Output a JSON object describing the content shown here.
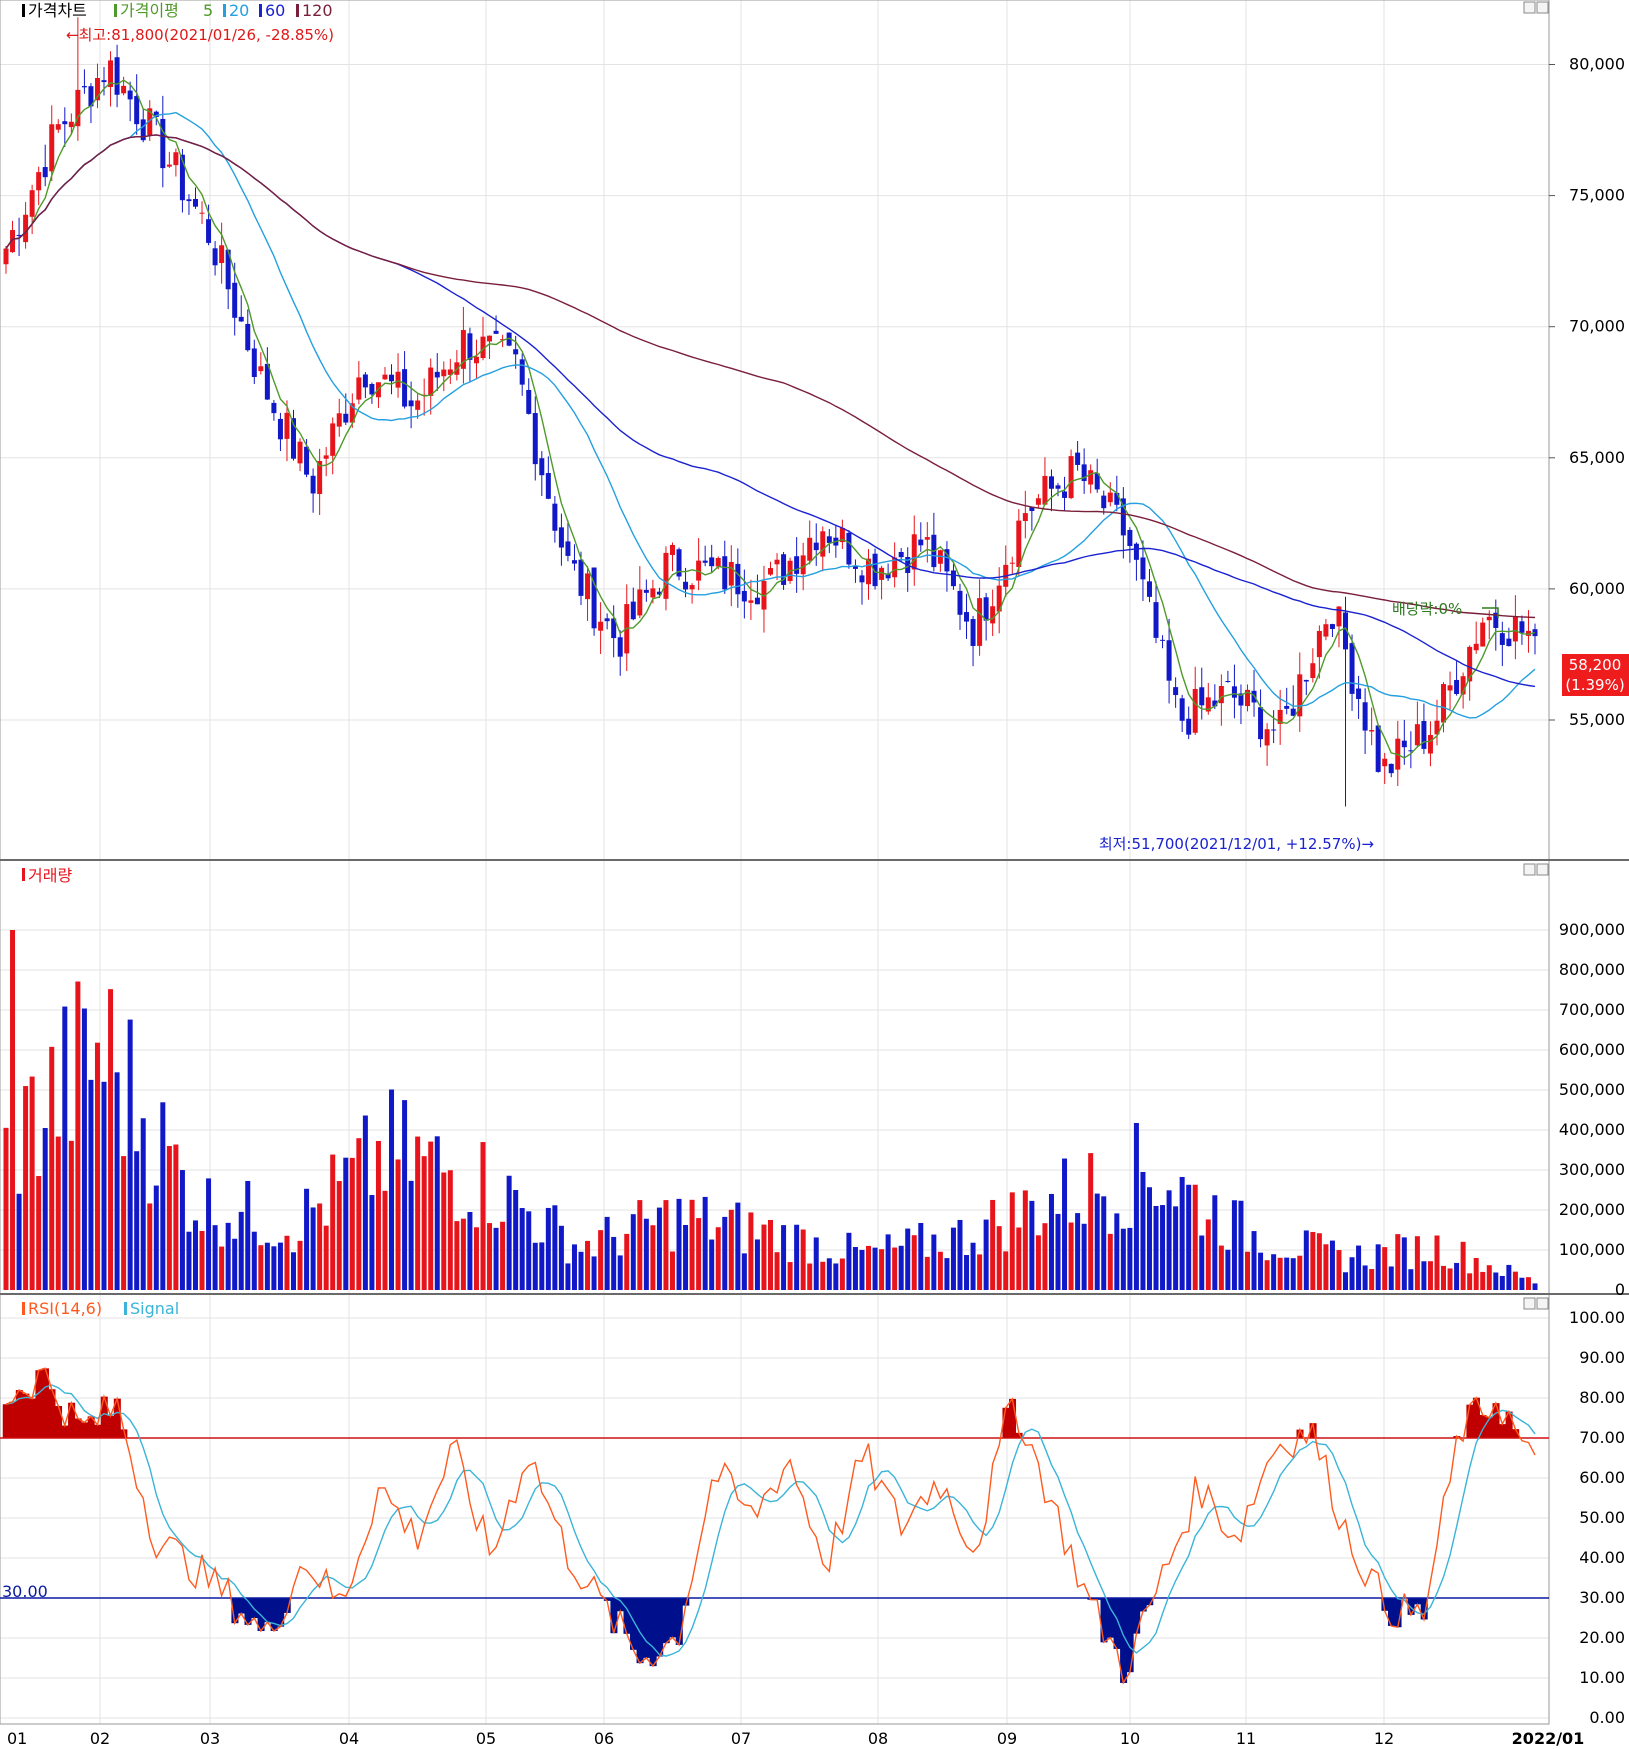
{
  "colors": {
    "up": "#e8141c",
    "down": "#1018c8",
    "ma5": "#4f9a2a",
    "ma20": "#24a0e0",
    "ma60": "#1a22d0",
    "ma120": "#7a1f3a",
    "grid": "#e3e3e3",
    "rsi": "#ff5a1e",
    "signal": "#3ab4d8",
    "overbought_fill": "#c00000",
    "oversold_fill": "#00108c",
    "ref70": "#d01010",
    "ref30": "#0a1aa0"
  },
  "price_panel": {
    "legend": {
      "title": "가격차트",
      "ma_label": "가격이평",
      "ma_periods": [
        "5",
        "20",
        "60",
        "120"
      ]
    },
    "high_annotation": "←최고:81,800(2021/01/26, -28.85%)",
    "low_annotation": "최저:51,700(2021/12/01, +12.57%)→",
    "dividend_annotation": "배당락:0%",
    "current_price_tag": "58,200",
    "current_change_tag": "(1.39%)",
    "y_ticks": [
      "80,000",
      "75,000",
      "70,000",
      "65,000",
      "60,000",
      "55,000"
    ]
  },
  "volume_panel": {
    "legend": "거래량",
    "y_ticks": [
      "900,000",
      "800,000",
      "700,000",
      "600,000",
      "500,000",
      "400,000",
      "300,000",
      "200,000",
      "100,000",
      "0"
    ]
  },
  "rsi_panel": {
    "legend_rsi": "RSI(14,6)",
    "legend_signal": "Signal",
    "ref_label": "30.00",
    "y_ticks": [
      "100.00",
      "90.00",
      "80.00",
      "70.00",
      "60.00",
      "50.00",
      "40.00",
      "30.00",
      "20.00",
      "10.00",
      "0.00"
    ]
  },
  "x_axis": {
    "labels": [
      "01",
      "02",
      "03",
      "04",
      "05",
      "06",
      "07",
      "08",
      "09",
      "10",
      "11",
      "12",
      "2022/01"
    ]
  },
  "chart_data": [
    {
      "type": "candlestick",
      "title": "가격차트",
      "ylim": [
        50000,
        84500
      ],
      "categories": [
        "2021/01",
        "2021/02",
        "2021/03",
        "2021/04",
        "2021/05",
        "2021/06",
        "2021/07",
        "2021/08",
        "2021/09",
        "2021/10",
        "2021/11",
        "2021/12",
        "2022/01"
      ],
      "high": {
        "value": 81800,
        "date": "2021/01/26",
        "change_pct": -28.85
      },
      "low": {
        "value": 51700,
        "date": "2021/12/01",
        "change_pct": 12.57
      },
      "last": {
        "value": 58200,
        "change_pct": 1.39
      },
      "close_path": [
        {
          "x": "2021/01 start",
          "y": 73000
        },
        {
          "x": "2021/01 mid",
          "y": 77500
        },
        {
          "x": "2021/01/26",
          "y": 80000
        },
        {
          "x": "2021/02 start",
          "y": 77000
        },
        {
          "x": "2021/02 mid",
          "y": 73500
        },
        {
          "x": "2021/02 end",
          "y": 68000
        },
        {
          "x": "2021/03 start",
          "y": 64000
        },
        {
          "x": "2021/03 mid",
          "y": 68500
        },
        {
          "x": "2021/03 end",
          "y": 67000
        },
        {
          "x": "2021/04 mid",
          "y": 69500
        },
        {
          "x": "2021/04 end",
          "y": 68500
        },
        {
          "x": "2021/05 mid",
          "y": 61000
        },
        {
          "x": "2021/05 end",
          "y": 58000
        },
        {
          "x": "2021/06 start",
          "y": 61000
        },
        {
          "x": "2021/06 mid",
          "y": 60500
        },
        {
          "x": "2021/07 start",
          "y": 60200
        },
        {
          "x": "2021/07 mid",
          "y": 62500
        },
        {
          "x": "2021/08 start",
          "y": 60800
        },
        {
          "x": "2021/08 mid",
          "y": 61800
        },
        {
          "x": "2021/08 end",
          "y": 58500
        },
        {
          "x": "2021/09 start",
          "y": 63000
        },
        {
          "x": "2021/09 mid",
          "y": 64500
        },
        {
          "x": "2021/10 start",
          "y": 62000
        },
        {
          "x": "2021/10 mid",
          "y": 55000
        },
        {
          "x": "2021/11 start",
          "y": 56000
        },
        {
          "x": "2021/11 mid",
          "y": 54500
        },
        {
          "x": "2021/11 end",
          "y": 59500
        },
        {
          "x": "2021/12/01",
          "y": 53000
        },
        {
          "x": "2021/12 mid",
          "y": 54800
        },
        {
          "x": "2021/12 end",
          "y": 59000
        },
        {
          "x": "2022/01",
          "y": 58200
        }
      ],
      "moving_averages": [
        "5",
        "20",
        "60",
        "120"
      ]
    },
    {
      "type": "bar",
      "title": "거래량",
      "ylim": [
        0,
        900000
      ],
      "series": [
        {
          "name": "거래량",
          "values": [
            520000,
            900000,
            320000,
            240000,
            510000,
            400000,
            160000,
            270000,
            210000,
            130000,
            200000,
            340000,
            440000,
            210000,
            120000,
            160000,
            30000
          ]
        }
      ]
    },
    {
      "type": "line",
      "title": "RSI(14,6)",
      "ylim": [
        0,
        100
      ],
      "reference_lines": [
        70,
        30
      ],
      "series": [
        {
          "name": "RSI(14,6)",
          "values": [
            80,
            86,
            72,
            78,
            45,
            38,
            30,
            20,
            40,
            28,
            58,
            45,
            67,
            40,
            67,
            42,
            28,
            15,
            20,
            62,
            50,
            65,
            38,
            66,
            48,
            60,
            42,
            80,
            55,
            30,
            12,
            35,
            58,
            45,
            68,
            72,
            45,
            28,
            25,
            72,
            80,
            62
          ]
        },
        {
          "name": "Signal",
          "values": [
            82,
            78,
            75,
            65,
            48,
            40,
            32,
            27,
            35,
            32,
            48,
            50,
            60,
            48,
            60,
            47,
            32,
            22,
            22,
            45,
            58,
            60,
            45,
            58,
            52,
            55,
            48,
            72,
            60,
            32,
            22,
            28,
            45,
            48,
            58,
            66,
            52,
            34,
            28,
            60,
            72,
            66
          ]
        }
      ]
    }
  ]
}
